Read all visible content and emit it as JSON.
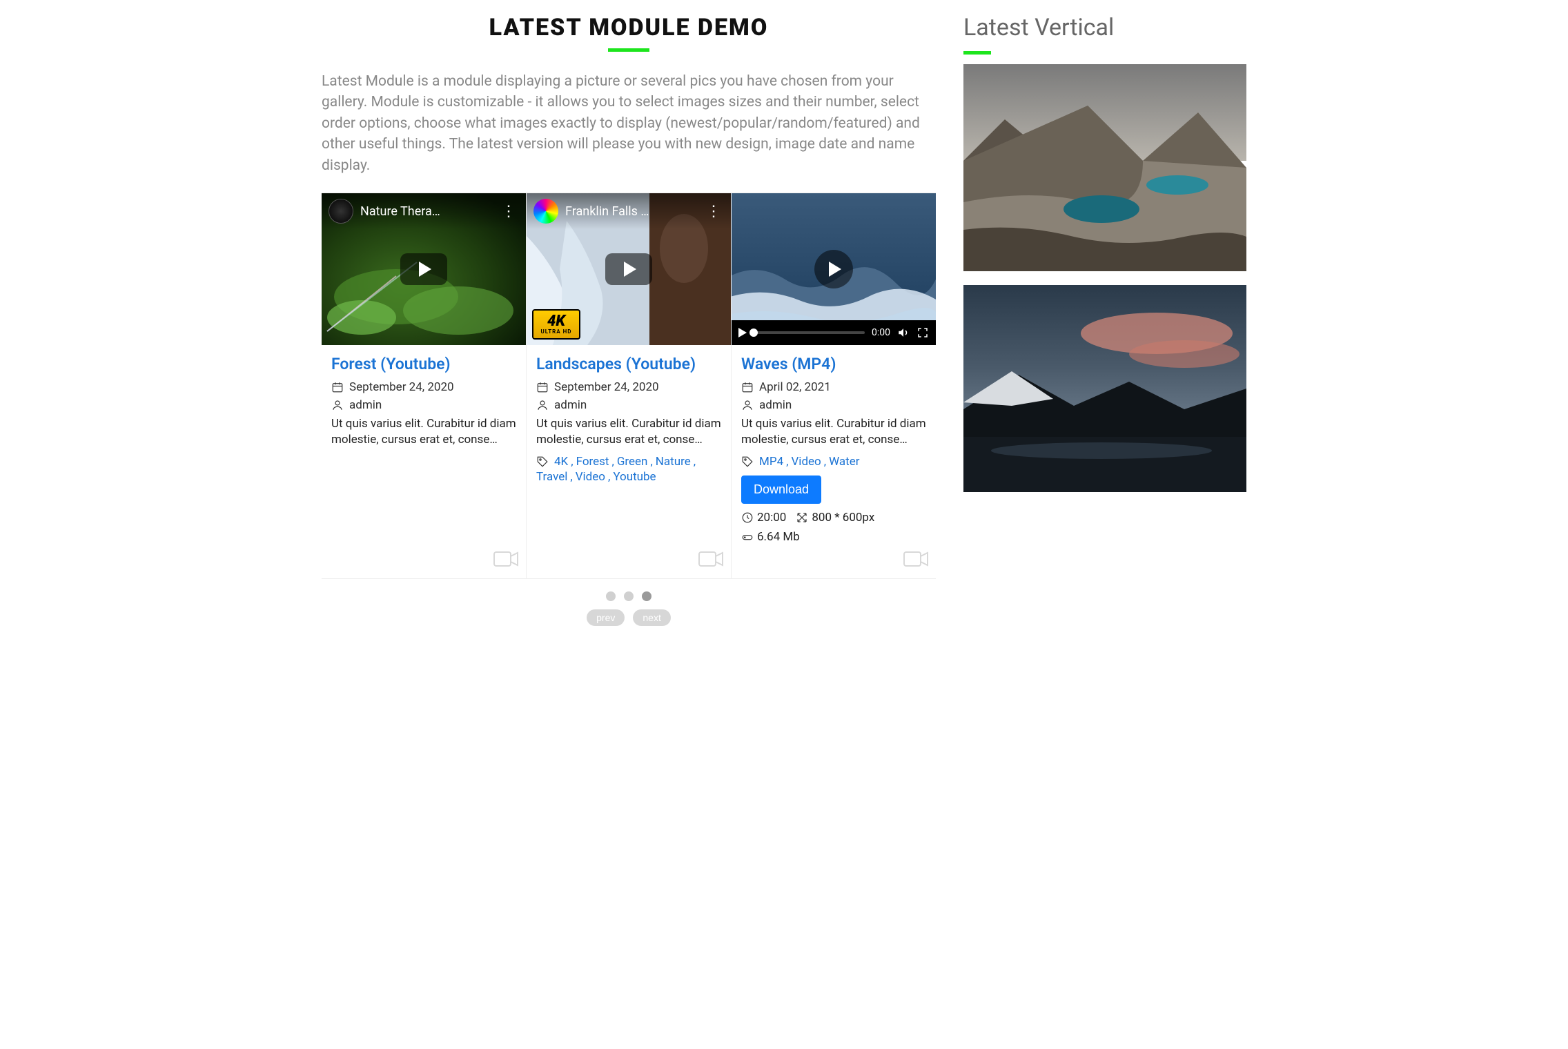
{
  "page_title": "LATEST MODULE DEMO",
  "intro": "Latest Module is a module displaying a picture or several pics you have chosen from your gallery. Module is customizable - it allows you to select images sizes and their number, select order options, choose what images exactly to display (newest/popular/random/featured) and other useful things. The latest version will please you with new design, image date and name display.",
  "cards": [
    {
      "yt_title": "Nature Thera…",
      "link_title": "Forest (Youtube)",
      "date": "September 24, 2020",
      "author": "admin",
      "desc": "Ut quis varius elit. Curabitur id diam molestie, cursus erat et, conse…",
      "tags": []
    },
    {
      "yt_title": "Franklin Falls …",
      "link_title": "Landscapes (Youtube)",
      "date": "September 24, 2020",
      "author": "admin",
      "desc": "Ut quis varius elit. Curabitur id diam molestie, cursus erat et, conse…",
      "tags": [
        "4K",
        "Forest",
        "Green",
        "Nature",
        "Travel",
        "Video",
        "Youtube"
      ],
      "badge4k": {
        "big": "4K",
        "small": "ULTRA HD"
      }
    },
    {
      "link_title": "Waves (MP4)",
      "date": "April 02, 2021",
      "author": "admin",
      "desc": "Ut quis varius elit. Curabitur id diam molestie, cursus erat et, conse…",
      "tags": [
        "MP4",
        "Video",
        "Water"
      ],
      "download_label": "Download",
      "time_label": "0:00",
      "info": {
        "duration": "20:00",
        "dimensions": "800 * 600px",
        "size": "6.64 Mb"
      }
    }
  ],
  "pager": {
    "prev": "prev",
    "next": "next",
    "active_index": 2,
    "dot_count": 3
  },
  "sidebar": {
    "title": "Latest Vertical"
  }
}
